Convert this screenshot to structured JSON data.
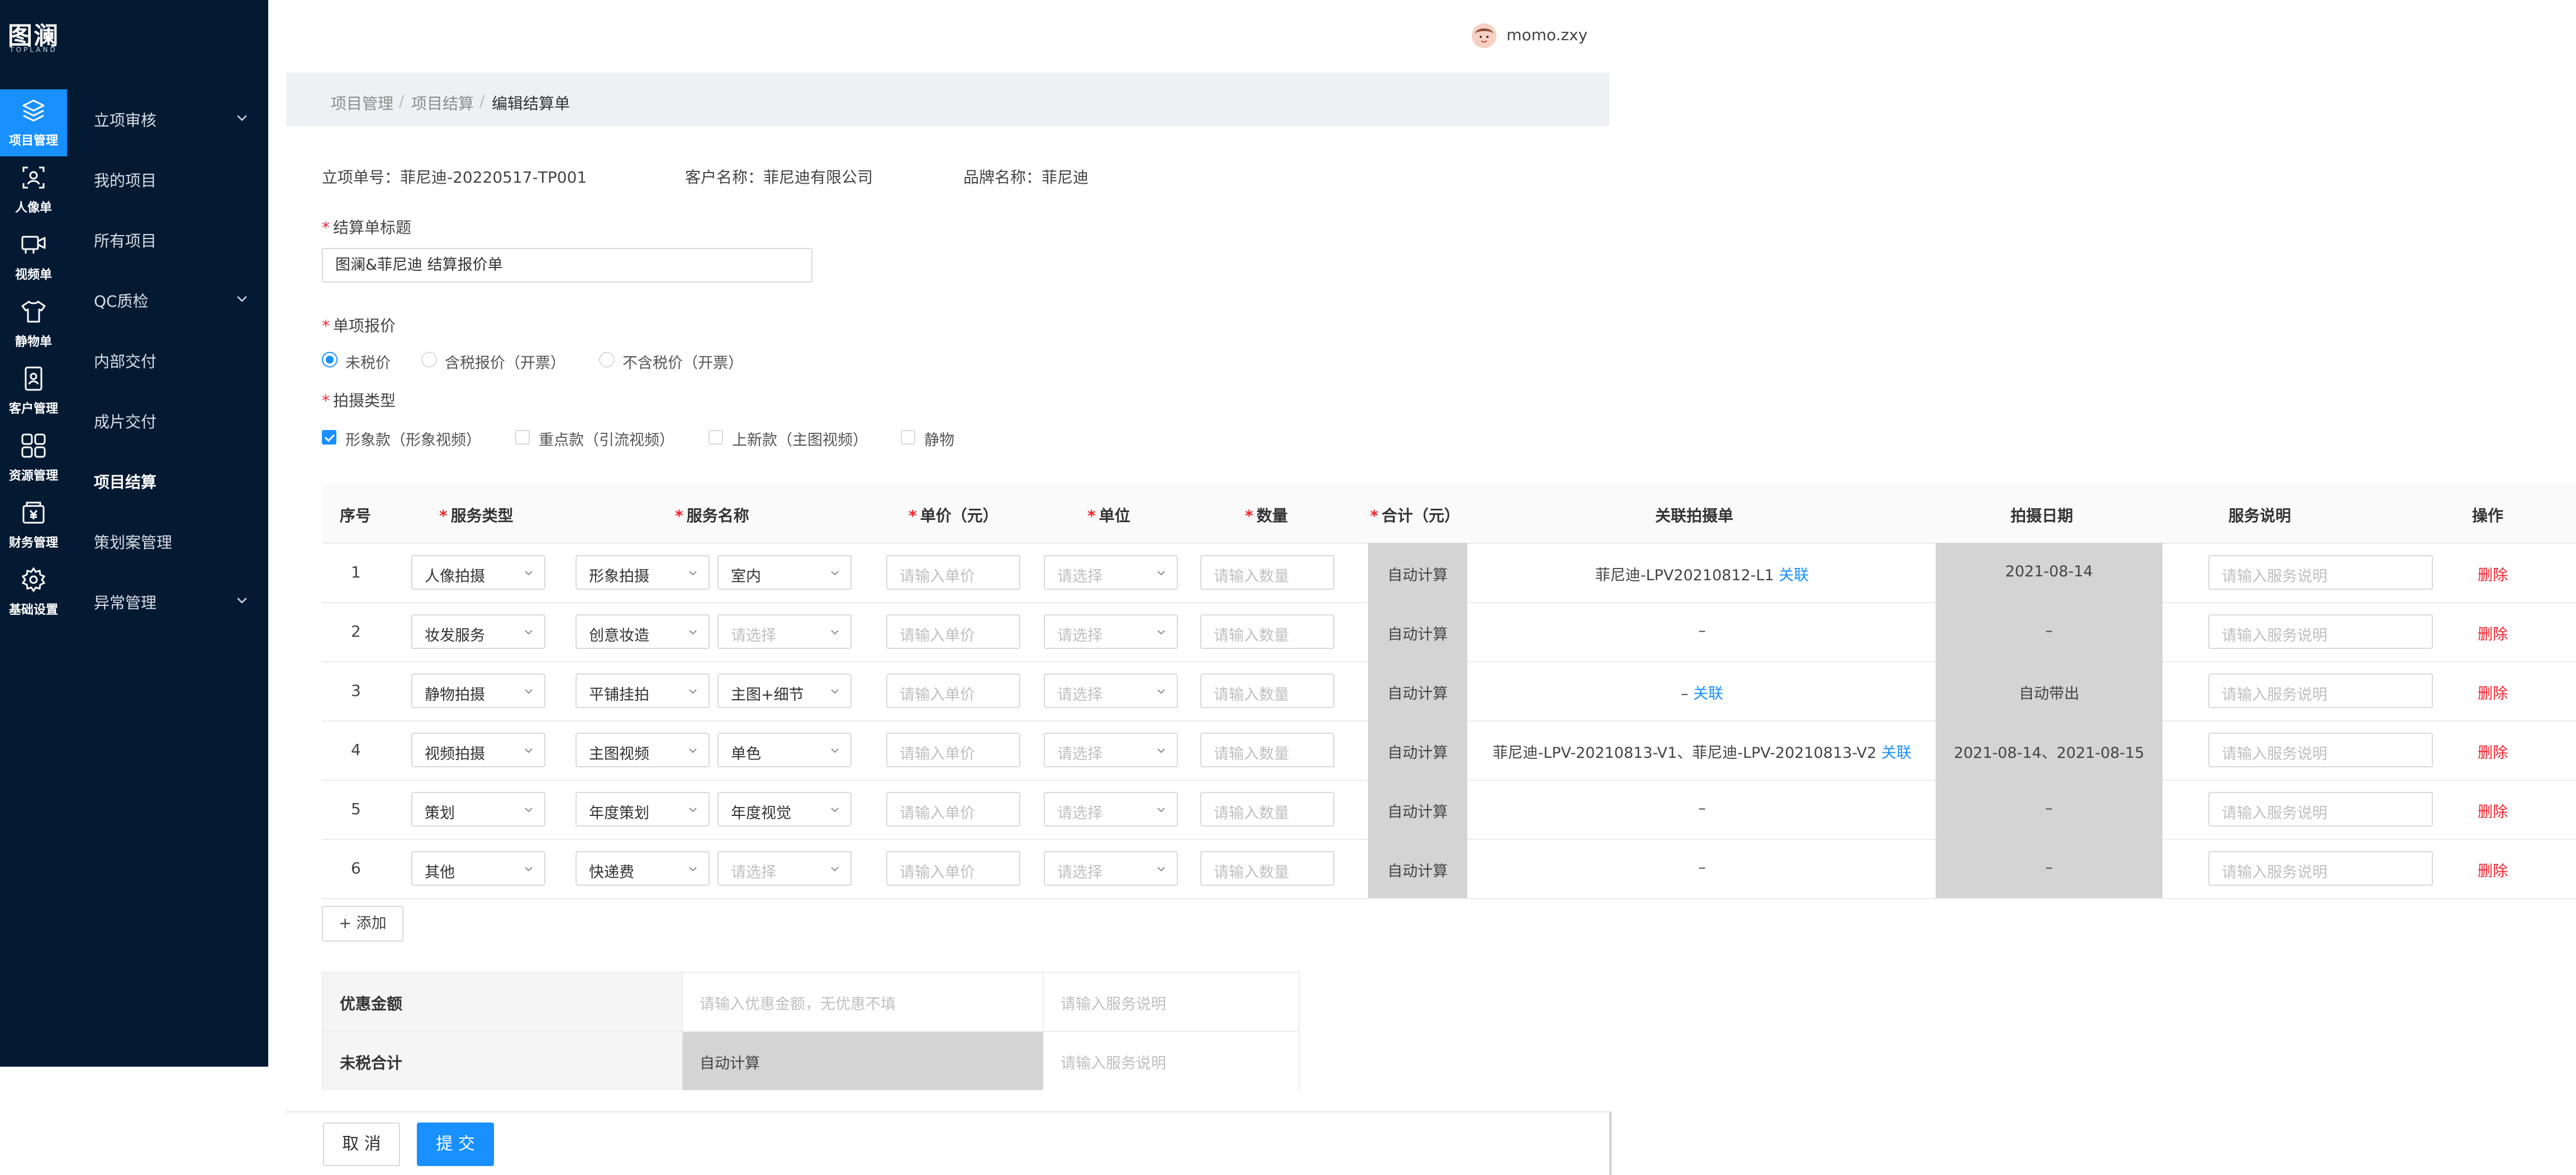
{
  "brand": {
    "logo_text": "图澜",
    "logo_sub": "TOPLAND"
  },
  "rail": [
    {
      "label": "项目管理",
      "icon": "layers-icon",
      "active": true
    },
    {
      "label": "人像单",
      "icon": "portrait-icon"
    },
    {
      "label": "视频单",
      "icon": "video-icon"
    },
    {
      "label": "静物单",
      "icon": "shirt-icon"
    },
    {
      "label": "客户管理",
      "icon": "customer-icon"
    },
    {
      "label": "资源管理",
      "icon": "grid-icon"
    },
    {
      "label": "财务管理",
      "icon": "finance-icon"
    },
    {
      "label": "基础设置",
      "icon": "gear-icon"
    }
  ],
  "menu": [
    {
      "label": "立项审核",
      "has_children": true
    },
    {
      "label": "我的项目"
    },
    {
      "label": "所有项目"
    },
    {
      "label": "QC质检",
      "has_children": true
    },
    {
      "label": "内部交付"
    },
    {
      "label": "成片交付"
    },
    {
      "label": "项目结算",
      "active": true
    },
    {
      "label": "策划案管理"
    },
    {
      "label": "异常管理",
      "has_children": true
    }
  ],
  "header": {
    "username": "momo.zxy"
  },
  "breadcrumb": [
    "项目管理",
    "项目结算",
    "编辑结算单"
  ],
  "meta": {
    "project_no": "立项单号：菲尼迪-20220517-TP001",
    "customer": "客户名称：菲尼迪有限公司",
    "brand": "品牌名称：菲尼迪"
  },
  "form": {
    "title_label": "结算单标题",
    "title_value": "图澜&菲尼迪 结算报价单",
    "price_label": "单项报价",
    "price_options": [
      "未税价",
      "含税报价（开票）",
      "不含税价（开票）"
    ],
    "price_selected": 0,
    "shoot_label": "拍摄类型",
    "shoot_options": [
      {
        "label": "形象款（形象视频）",
        "checked": true
      },
      {
        "label": "重点款（引流视频）",
        "checked": false
      },
      {
        "label": "上新款（主图视频）",
        "checked": false
      },
      {
        "label": "静物",
        "checked": false
      }
    ]
  },
  "table": {
    "headers": {
      "index": "序号",
      "service_type": "服务类型",
      "service_name": "服务名称",
      "unit_price": "单价（元）",
      "unit": "单位",
      "quantity": "数量",
      "total": "合计（元）",
      "linked": "关联拍摄单",
      "date": "拍摄日期",
      "note": "服务说明",
      "action": "操作"
    },
    "placeholders": {
      "unit_price": "请输入单价",
      "unit": "请选择",
      "quantity": "请输入数量",
      "note": "请输入服务说明",
      "select": "请选择"
    },
    "auto_calc": "自动计算",
    "link_label": "关联",
    "delete_label": "删除",
    "rows": [
      {
        "index": "1",
        "type": "人像拍摄",
        "name": "形象拍摄",
        "sub": "室内",
        "linked_text": "菲尼迪-LPV20210812-L1",
        "has_link": true,
        "date": "2021-08-14"
      },
      {
        "index": "2",
        "type": "妆发服务",
        "name": "创意妆造",
        "sub": "",
        "linked_text": "–",
        "has_link": false,
        "date": "–"
      },
      {
        "index": "3",
        "type": "静物拍摄",
        "name": "平铺挂拍",
        "sub": "主图+细节",
        "linked_text": "–",
        "has_link": true,
        "date": "自动带出"
      },
      {
        "index": "4",
        "type": "视频拍摄",
        "name": "主图视频",
        "sub": "单色",
        "linked_text": "菲尼迪-LPV-20210813-V1、菲尼迪-LPV-20210813-V2",
        "has_link": true,
        "date": "2021-08-14、2021-08-15"
      },
      {
        "index": "5",
        "type": "策划",
        "name": "年度策划",
        "sub": "年度视觉",
        "linked_text": "–",
        "has_link": false,
        "date": "–"
      },
      {
        "index": "6",
        "type": "其他",
        "name": "快递费",
        "sub": "",
        "linked_text": "–",
        "has_link": false,
        "date": "–"
      }
    ],
    "add_label": "+ 添加"
  },
  "summary": {
    "discount_label": "优惠金额",
    "discount_placeholder": "请输入优惠金额，无优惠不填",
    "note_placeholder": "请输入服务说明",
    "total_label": "未税合计",
    "total_value": "自动计算"
  },
  "footer": {
    "cancel": "取 消",
    "submit": "提 交"
  },
  "colors": {
    "sidebar_bg": "#041a33",
    "primary": "#1890ff",
    "danger": "#f5222d",
    "auto_cell": "#d4d4d4"
  }
}
